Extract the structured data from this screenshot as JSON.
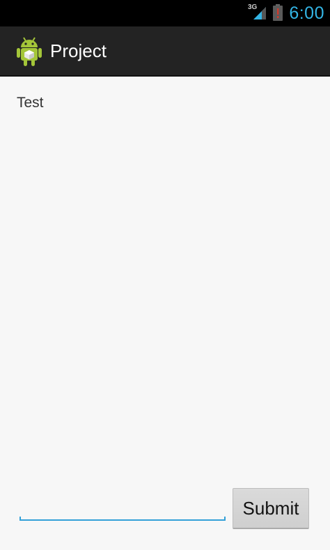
{
  "status_bar": {
    "network_type": "3G",
    "time": "6:00",
    "icons": [
      "signal-icon",
      "battery-alert-icon"
    ]
  },
  "action_bar": {
    "app_icon": "android-app-icon",
    "title": "Project"
  },
  "content": {
    "message": "Test"
  },
  "form": {
    "input_value": "",
    "input_placeholder": "",
    "submit_label": "Submit"
  },
  "colors": {
    "accent": "#33b5e5",
    "action_bar_bg": "#232323",
    "content_bg": "#f7f7f7",
    "android_green": "#a4c639",
    "battery_alert": "#cc3b2e"
  }
}
